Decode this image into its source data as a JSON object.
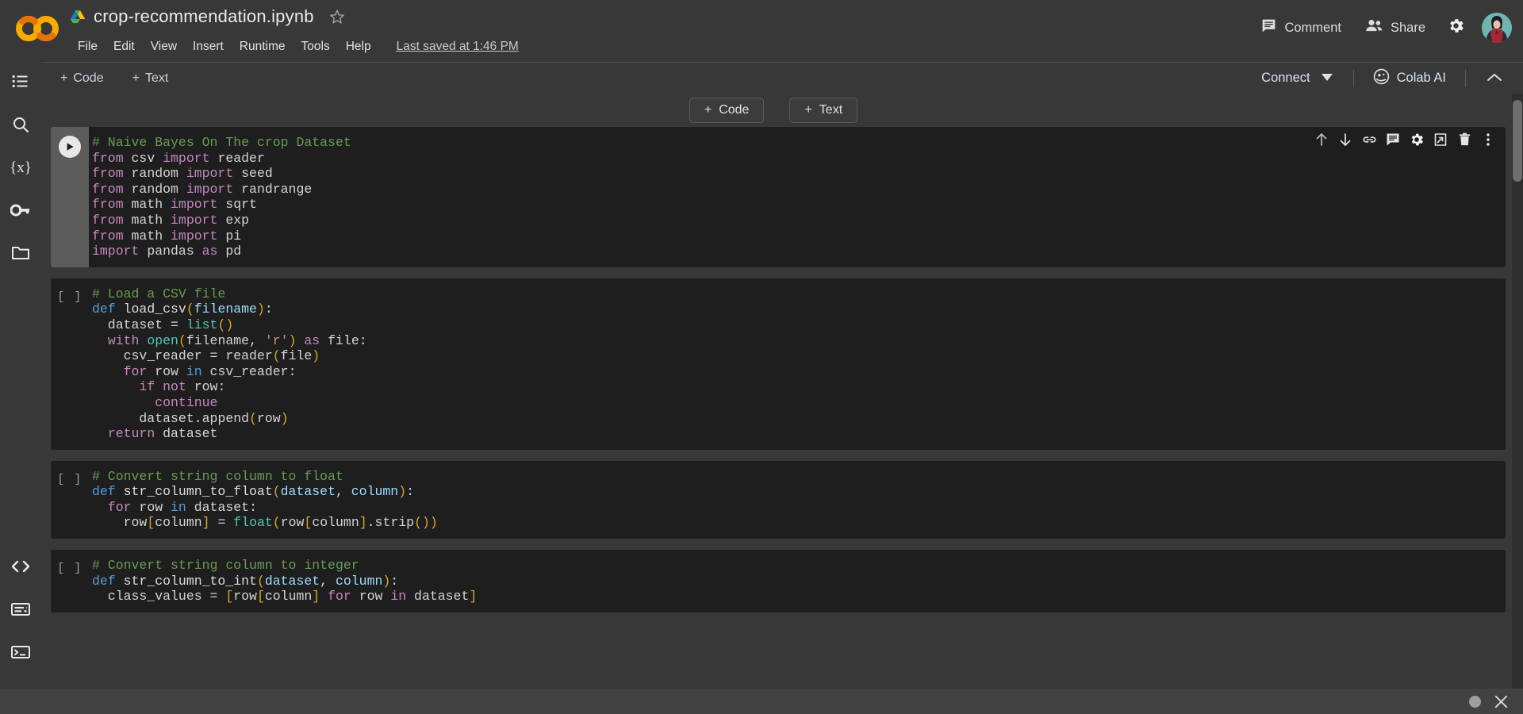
{
  "app": {
    "logo_alt": "Colab logo",
    "notebook_title": "crop-recommendation.ipynb",
    "drive_icon": "drive-icon",
    "star_icon": "star-icon"
  },
  "menu": {
    "items": [
      "File",
      "Edit",
      "View",
      "Insert",
      "Runtime",
      "Tools",
      "Help"
    ],
    "saved_status": "Last saved at 1:46 PM"
  },
  "topbar_right": {
    "comment_label": "Comment",
    "comment_icon": "comment-icon",
    "share_label": "Share",
    "share_icon": "people-icon",
    "settings_icon": "gear-icon",
    "avatar_label": "account-avatar"
  },
  "subbar": {
    "add_code_label": "Code",
    "add_text_label": "Text",
    "plus_glyph": "+",
    "connect_label": "Connect",
    "connect_caret": "chevron-down-icon",
    "colab_ai_label": "Colab AI",
    "colab_ai_icon": "colab-ai-icon",
    "collapse_icon": "chevron-up-icon"
  },
  "sidebar": {
    "top_items": [
      {
        "name": "table-of-contents",
        "icon": "list-icon"
      },
      {
        "name": "find-and-replace",
        "icon": "search-icon"
      },
      {
        "name": "variables",
        "icon": "variables-icon"
      },
      {
        "name": "secrets",
        "icon": "key-icon"
      },
      {
        "name": "files",
        "icon": "folder-icon"
      }
    ],
    "bottom_items": [
      {
        "name": "code-snippets",
        "icon": "code-brackets-icon"
      },
      {
        "name": "command-palette",
        "icon": "command-palette-icon"
      },
      {
        "name": "terminal",
        "icon": "terminal-icon"
      }
    ]
  },
  "floating_add": {
    "code_label": "Code",
    "text_label": "Text",
    "plus_glyph": "+"
  },
  "cell_toolbar": {
    "buttons": [
      {
        "name": "move-cell-up-button",
        "icon": "arrow-up-icon"
      },
      {
        "name": "move-cell-down-button",
        "icon": "arrow-down-icon"
      },
      {
        "name": "link-to-cell-button",
        "icon": "link-icon"
      },
      {
        "name": "add-comment-button",
        "icon": "comment-icon"
      },
      {
        "name": "cell-settings-button",
        "icon": "gear-icon"
      },
      {
        "name": "mirror-cell-button",
        "icon": "open-in-new-icon"
      },
      {
        "name": "delete-cell-button",
        "icon": "trash-icon"
      },
      {
        "name": "more-cell-actions-button",
        "icon": "more-vert-icon"
      }
    ]
  },
  "bottombar": {
    "status_dot": "status-dot",
    "close_icon": "close-icon"
  },
  "cells": [
    {
      "id": "cell-1",
      "focused": true,
      "run_indicator": "run-button",
      "lines": [
        [
          {
            "t": "# Naive Bayes On The crop Dataset",
            "c": "tk-com"
          }
        ],
        [
          {
            "t": "from ",
            "c": "tk-kw"
          },
          {
            "t": "csv ",
            "c": "tk-id"
          },
          {
            "t": "import ",
            "c": "tk-kw"
          },
          {
            "t": "reader",
            "c": "tk-id"
          }
        ],
        [
          {
            "t": "from ",
            "c": "tk-kw"
          },
          {
            "t": "random ",
            "c": "tk-id"
          },
          {
            "t": "import ",
            "c": "tk-kw"
          },
          {
            "t": "seed",
            "c": "tk-id"
          }
        ],
        [
          {
            "t": "from ",
            "c": "tk-kw"
          },
          {
            "t": "random ",
            "c": "tk-id"
          },
          {
            "t": "import ",
            "c": "tk-kw"
          },
          {
            "t": "randrange",
            "c": "tk-id"
          }
        ],
        [
          {
            "t": "from ",
            "c": "tk-kw"
          },
          {
            "t": "math ",
            "c": "tk-id"
          },
          {
            "t": "import ",
            "c": "tk-kw"
          },
          {
            "t": "sqrt",
            "c": "tk-id"
          }
        ],
        [
          {
            "t": "from ",
            "c": "tk-kw"
          },
          {
            "t": "math ",
            "c": "tk-id"
          },
          {
            "t": "import ",
            "c": "tk-kw"
          },
          {
            "t": "exp",
            "c": "tk-id"
          }
        ],
        [
          {
            "t": "from ",
            "c": "tk-kw"
          },
          {
            "t": "math ",
            "c": "tk-id"
          },
          {
            "t": "import ",
            "c": "tk-kw"
          },
          {
            "t": "pi",
            "c": "tk-id"
          }
        ],
        [
          {
            "t": "import ",
            "c": "tk-kw"
          },
          {
            "t": "pandas ",
            "c": "tk-id"
          },
          {
            "t": "as ",
            "c": "tk-kw"
          },
          {
            "t": "pd",
            "c": "tk-id"
          }
        ]
      ]
    },
    {
      "id": "cell-2",
      "focused": false,
      "run_indicator": "[ ]",
      "lines": [
        [
          {
            "t": "# Load a CSV file",
            "c": "tk-com"
          }
        ],
        [
          {
            "t": "def ",
            "c": "tk-def"
          },
          {
            "t": "load_csv",
            "c": "tk-fn"
          },
          {
            "t": "(",
            "c": "tk-par"
          },
          {
            "t": "filename",
            "c": "tk-arg"
          },
          {
            "t": ")",
            "c": "tk-par"
          },
          {
            "t": ":",
            "c": "tk-op"
          }
        ],
        [
          {
            "t": "  dataset ",
            "c": "tk-id"
          },
          {
            "t": "= ",
            "c": "tk-op"
          },
          {
            "t": "list",
            "c": "tk-bi"
          },
          {
            "t": "()",
            "c": "tk-par"
          }
        ],
        [
          {
            "t": "  ",
            "c": "tk-id"
          },
          {
            "t": "with ",
            "c": "tk-kw"
          },
          {
            "t": "open",
            "c": "tk-bi"
          },
          {
            "t": "(",
            "c": "tk-par"
          },
          {
            "t": "filename",
            "c": "tk-id"
          },
          {
            "t": ", ",
            "c": "tk-op"
          },
          {
            "t": "'r'",
            "c": "tk-str"
          },
          {
            "t": ")",
            "c": "tk-par"
          },
          {
            "t": " ",
            "c": "tk-op"
          },
          {
            "t": "as ",
            "c": "tk-kw"
          },
          {
            "t": "file",
            "c": "tk-id"
          },
          {
            "t": ":",
            "c": "tk-op"
          }
        ],
        [
          {
            "t": "    csv_reader ",
            "c": "tk-id"
          },
          {
            "t": "= ",
            "c": "tk-op"
          },
          {
            "t": "reader",
            "c": "tk-id"
          },
          {
            "t": "(",
            "c": "tk-par"
          },
          {
            "t": "file",
            "c": "tk-id"
          },
          {
            "t": ")",
            "c": "tk-par"
          }
        ],
        [
          {
            "t": "    ",
            "c": "tk-id"
          },
          {
            "t": "for ",
            "c": "tk-kw"
          },
          {
            "t": "row ",
            "c": "tk-id"
          },
          {
            "t": "in ",
            "c": "tk-def"
          },
          {
            "t": "csv_reader",
            "c": "tk-id"
          },
          {
            "t": ":",
            "c": "tk-op"
          }
        ],
        [
          {
            "t": "      ",
            "c": "tk-id"
          },
          {
            "t": "if ",
            "c": "tk-kw"
          },
          {
            "t": "not ",
            "c": "tk-kw"
          },
          {
            "t": "row",
            "c": "tk-id"
          },
          {
            "t": ":",
            "c": "tk-op"
          }
        ],
        [
          {
            "t": "        ",
            "c": "tk-id"
          },
          {
            "t": "continue",
            "c": "tk-kw"
          }
        ],
        [
          {
            "t": "      dataset",
            "c": "tk-id"
          },
          {
            "t": ".",
            "c": "tk-op"
          },
          {
            "t": "append",
            "c": "tk-id"
          },
          {
            "t": "(",
            "c": "tk-par"
          },
          {
            "t": "row",
            "c": "tk-id"
          },
          {
            "t": ")",
            "c": "tk-par"
          }
        ],
        [
          {
            "t": "  ",
            "c": "tk-id"
          },
          {
            "t": "return ",
            "c": "tk-kw"
          },
          {
            "t": "dataset",
            "c": "tk-id"
          }
        ]
      ]
    },
    {
      "id": "cell-3",
      "focused": false,
      "run_indicator": "[ ]",
      "lines": [
        [
          {
            "t": "# Convert string column to float",
            "c": "tk-com"
          }
        ],
        [
          {
            "t": "def ",
            "c": "tk-def"
          },
          {
            "t": "str_column_to_float",
            "c": "tk-fn"
          },
          {
            "t": "(",
            "c": "tk-par"
          },
          {
            "t": "dataset",
            "c": "tk-arg"
          },
          {
            "t": ", ",
            "c": "tk-op"
          },
          {
            "t": "column",
            "c": "tk-arg"
          },
          {
            "t": ")",
            "c": "tk-par"
          },
          {
            "t": ":",
            "c": "tk-op"
          }
        ],
        [
          {
            "t": "  ",
            "c": "tk-id"
          },
          {
            "t": "for ",
            "c": "tk-kw"
          },
          {
            "t": "row ",
            "c": "tk-id"
          },
          {
            "t": "in ",
            "c": "tk-def"
          },
          {
            "t": "dataset",
            "c": "tk-id"
          },
          {
            "t": ":",
            "c": "tk-op"
          }
        ],
        [
          {
            "t": "    row",
            "c": "tk-id"
          },
          {
            "t": "[",
            "c": "tk-par"
          },
          {
            "t": "column",
            "c": "tk-id"
          },
          {
            "t": "]",
            "c": "tk-par"
          },
          {
            "t": " = ",
            "c": "tk-op"
          },
          {
            "t": "float",
            "c": "tk-bi"
          },
          {
            "t": "(",
            "c": "tk-par"
          },
          {
            "t": "row",
            "c": "tk-id"
          },
          {
            "t": "[",
            "c": "tk-par"
          },
          {
            "t": "column",
            "c": "tk-id"
          },
          {
            "t": "]",
            "c": "tk-par"
          },
          {
            "t": ".",
            "c": "tk-op"
          },
          {
            "t": "strip",
            "c": "tk-id"
          },
          {
            "t": "())",
            "c": "tk-par"
          }
        ]
      ]
    },
    {
      "id": "cell-4",
      "focused": false,
      "run_indicator": "[ ]",
      "lines": [
        [
          {
            "t": "# Convert string column to integer",
            "c": "tk-com"
          }
        ],
        [
          {
            "t": "def ",
            "c": "tk-def"
          },
          {
            "t": "str_column_to_int",
            "c": "tk-fn"
          },
          {
            "t": "(",
            "c": "tk-par"
          },
          {
            "t": "dataset",
            "c": "tk-arg"
          },
          {
            "t": ", ",
            "c": "tk-op"
          },
          {
            "t": "column",
            "c": "tk-arg"
          },
          {
            "t": ")",
            "c": "tk-par"
          },
          {
            "t": ":",
            "c": "tk-op"
          }
        ],
        [
          {
            "t": "  class_values ",
            "c": "tk-id"
          },
          {
            "t": "= ",
            "c": "tk-op"
          },
          {
            "t": "[",
            "c": "tk-par"
          },
          {
            "t": "row",
            "c": "tk-id"
          },
          {
            "t": "[",
            "c": "tk-par"
          },
          {
            "t": "column",
            "c": "tk-id"
          },
          {
            "t": "] ",
            "c": "tk-par"
          },
          {
            "t": "for ",
            "c": "tk-kw"
          },
          {
            "t": "row ",
            "c": "tk-id"
          },
          {
            "t": "in ",
            "c": "tk-kw"
          },
          {
            "t": "dataset",
            "c": "tk-id"
          },
          {
            "t": "]",
            "c": "tk-par"
          }
        ]
      ]
    }
  ],
  "colors": {
    "chrome_bg": "#383838",
    "cell_bg": "#1e1e1e",
    "accent_orange": "#f9ab00",
    "link_blue": "#8ab4f8",
    "comment_green": "#6a9955",
    "keyword_pink": "#c586c0"
  }
}
